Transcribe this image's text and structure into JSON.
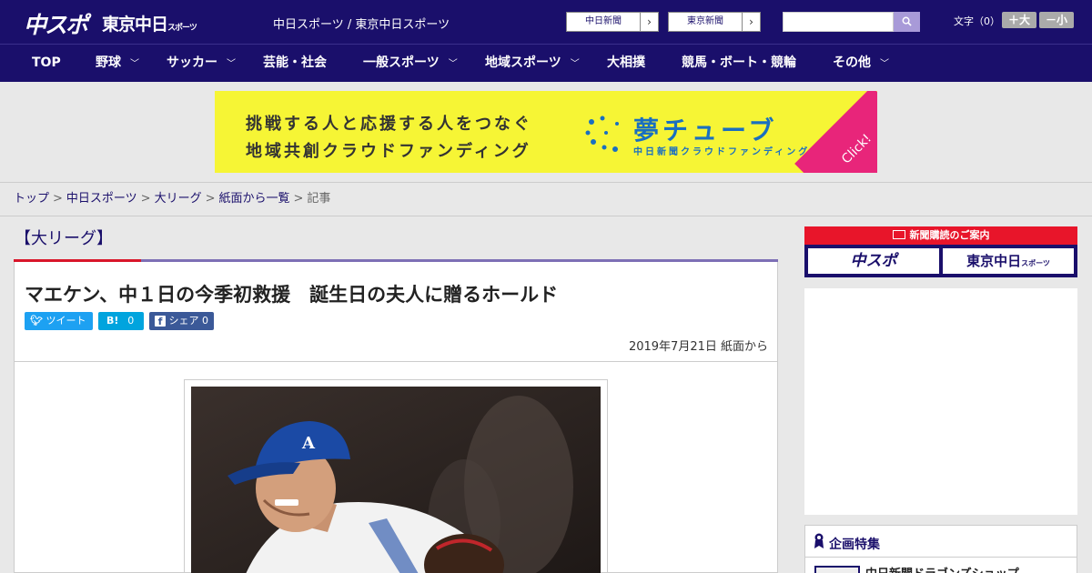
{
  "header": {
    "logo_chunichi": "中スポ",
    "logo_tokyo": "東京中日",
    "logo_tokyo_small": "スポーツ",
    "site_name": "中日スポーツ / 東京中日スポーツ",
    "paper_links": [
      {
        "label": "中日新聞"
      },
      {
        "label": "東京新聞"
      }
    ],
    "search_placeholder": "",
    "font_size_label": "文字（0）",
    "font_larger": "＋大",
    "font_smaller": "－小"
  },
  "nav": {
    "items": [
      {
        "label": "TOP",
        "has_dropdown": false
      },
      {
        "label": "野球",
        "has_dropdown": true
      },
      {
        "label": "サッカー",
        "has_dropdown": true
      },
      {
        "label": "芸能・社会",
        "has_dropdown": false
      },
      {
        "label": "一般スポーツ",
        "has_dropdown": true
      },
      {
        "label": "地域スポーツ",
        "has_dropdown": true
      },
      {
        "label": "大相撲",
        "has_dropdown": false
      },
      {
        "label": "競馬・ボート・競輪",
        "has_dropdown": false
      },
      {
        "label": "その他",
        "has_dropdown": true
      }
    ]
  },
  "banner": {
    "line1": "挑戦する人と応援する人をつなぐ",
    "line2": "地域共創クラウドファンディング",
    "brand": "夢チューブ",
    "brand_sub": "中日新聞クラウドファンディング",
    "click": "Click!",
    "colors": {
      "bg": "#f6f535",
      "brand": "#1a6fc0",
      "click_bg": "#e8257a"
    }
  },
  "breadcrumb": {
    "items": [
      {
        "label": "トップ"
      },
      {
        "label": "中日スポーツ"
      },
      {
        "label": "大リーグ"
      },
      {
        "label": "紙面から一覧"
      }
    ],
    "current": "記事"
  },
  "article": {
    "category": "【大リーグ】",
    "headline": "マエケン、中１日の今季初救援　誕生日の夫人に贈るホールド",
    "share": {
      "tweet": "ツイート",
      "hatena": "B!",
      "hatena_count": "0",
      "facebook": "シェア",
      "facebook_count": "0"
    },
    "date": "2019年7月21日 紙面から"
  },
  "sidebar": {
    "subscribe_title": "新聞購読のご案内",
    "subscribe_chunichi": "中スポ",
    "subscribe_tokyo": "東京中日",
    "subscribe_tokyo_small": "スポーツ",
    "feature_title": "企画特集",
    "feature_item": "中日新聞ドラゴンズショップ"
  },
  "colors": {
    "header_bg": "#1a0f6b",
    "accent_red": "#d9162a",
    "accent_purple": "#7d6fb5",
    "twitter": "#1da1f2",
    "hatena": "#00a4de",
    "facebook": "#3b5998"
  }
}
